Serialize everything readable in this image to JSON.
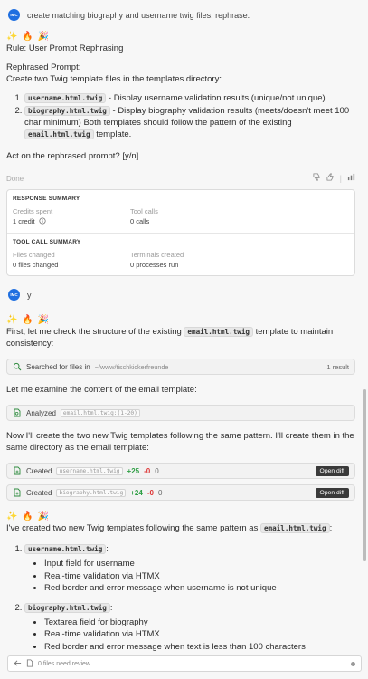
{
  "first_user_message": {
    "avatar": "IMC",
    "text": "create matching biography and username twig files. rephrase."
  },
  "response1": {
    "emojis": "✨ 🔥 🎉",
    "rule": "Rule: User Prompt Rephrasing",
    "rephrased_heading": "Rephrased Prompt:",
    "intro": "Create two Twig template files in the templates directory:",
    "items": [
      {
        "code": "username.html.twig",
        "text": " - Display username validation results (unique/not unique)"
      },
      {
        "code": "biography.html.twig",
        "text": " - Display biography validation results (meets/doesn't meet 100 char minimum) Both templates should follow the pattern of the existing ",
        "code2": "email.html.twig",
        "text2": " template."
      }
    ],
    "question": "Act on the rephrased prompt? [y/n]",
    "done_label": "Done"
  },
  "summary": {
    "response_title": "RESPONSE SUMMARY",
    "credits_label": "Credits spent",
    "credits_value": "1 credit",
    "toolcalls_label": "Tool calls",
    "toolcalls_value": "0 calls",
    "tool_title": "TOOL CALL SUMMARY",
    "files_label": "Files changed",
    "files_value": "0 files changed",
    "terminals_label": "Terminals created",
    "terminals_value": "0 processes run"
  },
  "second_user_message": {
    "avatar": "IMC",
    "text": "y"
  },
  "response2": {
    "emojis": "✨ 🔥 🎉",
    "check_pre": "First, let me check the structure of the existing ",
    "check_code": "email.html.twig",
    "check_post": " template to maintain consistency:",
    "search_label": "Searched for files in",
    "search_path": "~/www/tischkickerfreunde",
    "search_result": "1 result",
    "examine": "Let me examine the content of the email template:",
    "analyzed_label": "Analyzed",
    "analyzed_file": "email.html.twig:(1-20)",
    "create_text": "Now I'll create the two new Twig templates following the same pattern. I'll create them in the same directory as the email template:",
    "created": [
      {
        "label": "Created",
        "file": "username.html.twig",
        "plus": "+25",
        "minus": "-0",
        "zero": "0",
        "button": "Open diff"
      },
      {
        "label": "Created",
        "file": "biography.html.twig",
        "plus": "+24",
        "minus": "-0",
        "zero": "0",
        "button": "Open diff"
      }
    ]
  },
  "response3": {
    "emojis": "✨ 🔥 🎉",
    "intro_pre": "I've created two new Twig templates following the same pattern as ",
    "intro_code": "email.html.twig",
    "intro_post": ":",
    "templates": [
      {
        "code": "username.html.twig",
        "bullets": [
          "Input field for username",
          "Real-time validation via HTMX",
          "Red border and error message when username is not unique"
        ]
      },
      {
        "code": "biography.html.twig",
        "bullets": [
          "Textarea field for biography",
          "Real-time validation via HTMX",
          "Red border and error message when text is less than 100 characters"
        ]
      }
    ]
  },
  "footer": {
    "text": "0 files need review"
  },
  "colors": {
    "accent": "#1f6fe0",
    "plus": "#2e9e44",
    "minus": "#dd3333",
    "button_dark": "#3a3a3a"
  },
  "icons": [
    "search-icon",
    "file-analyze-icon",
    "file-created-icon",
    "thumb-down-icon",
    "thumb-up-icon",
    "stats-icon",
    "info-icon",
    "back-arrow-icon",
    "file-icon"
  ]
}
